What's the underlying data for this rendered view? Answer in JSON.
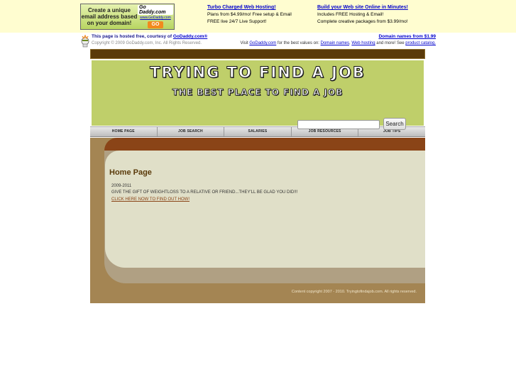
{
  "ad_bar": {
    "email_ad": {
      "text": "Create a unique email address based on your domain!",
      "logo": "Go Daddy.com",
      "url": "www.GoDaddy.com",
      "go_label": "GO"
    },
    "promos": [
      {
        "title": "Turbo Charged Web Hosting!",
        "line1": "Plans from $4.99/mo! Free setup & Email",
        "line2": "FREE live 24/7 Live Support!"
      },
      {
        "title": "Build your Web site Online in Minutes!",
        "line1": "Includes FREE Hosting & Email!",
        "line2": "Complete creative packages from $3.99/mo!"
      }
    ]
  },
  "hosted": {
    "line1_prefix": "This page is hosted free, courtesy of ",
    "line1_link": "GoDaddy.com®",
    "copyright": "Copyright © 2009 GoDaddy.com, Inc. All Rights Reserved.",
    "domain_link": "Domain names from $1.99",
    "visit_prefix": "Visit ",
    "visit_link": "GoDaddy.com",
    "visit_mid": " for the best values on: ",
    "link_domains": "Domain names",
    "sep": ", ",
    "link_hosting": "Web hosting",
    "visit_suffix": " and more! See ",
    "link_catalog": "product catalog."
  },
  "site": {
    "title": "TRYING TO FIND A JOB",
    "tagline": "THE BEST PLACE TO FIND A JOB",
    "nav": [
      "HOME PAGE",
      "JOB SEARCH",
      "SALARIES",
      "JOB RESOURCES",
      "JOB TIPS"
    ],
    "search": {
      "value": "",
      "button_label": "Search"
    },
    "content": {
      "heading": "Home Page",
      "date_range": "2009-2011",
      "promo_text": "GIVE THE GIFT OF WEIGHTLOSS TO A RELATIVE OR FRIEND...THEY'LL BE GLAD YOU DID!!!",
      "promo_link": "CLICK HERE NOW TO FIND OUT HOW!"
    },
    "footer": "Content copyright 2007 - 2010. Tryingtofindajob.com. All rights reserved."
  }
}
